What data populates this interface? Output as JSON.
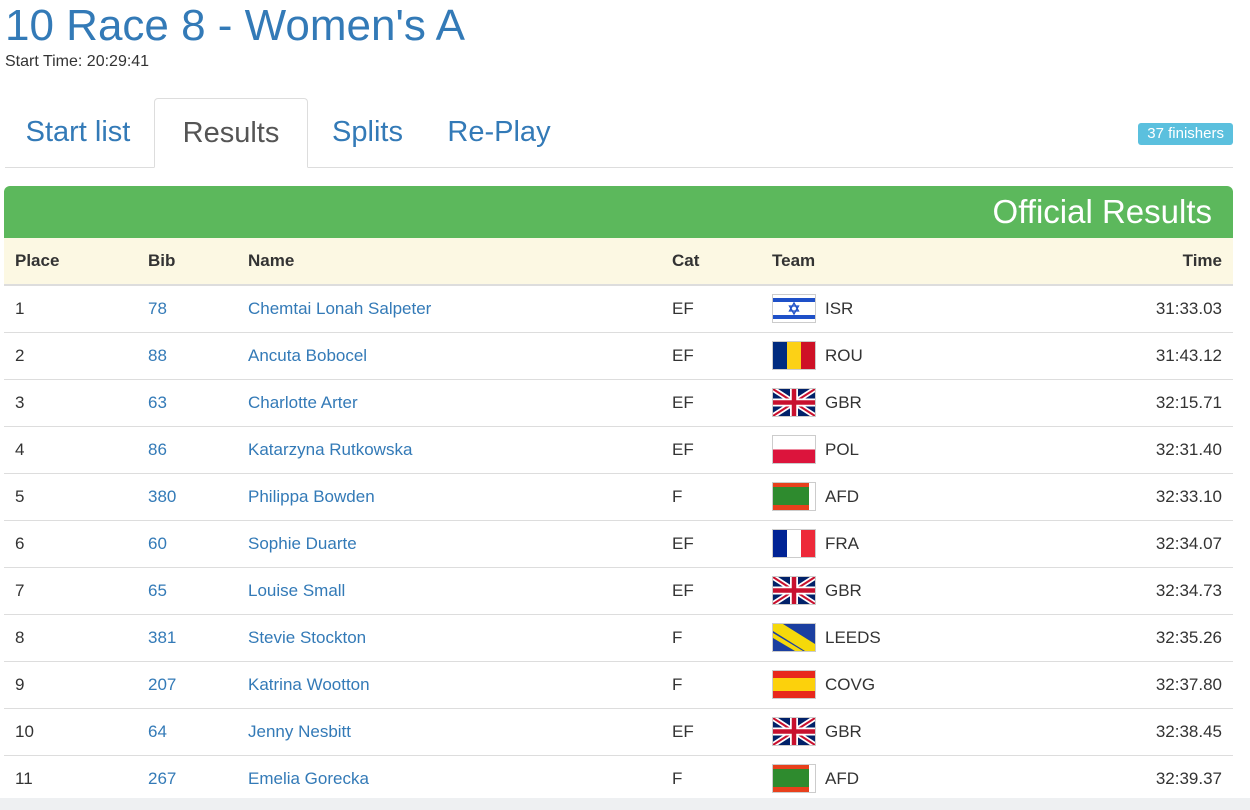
{
  "page": {
    "title": "10 Race 8 - Women's A",
    "start_time": "Start Time: 20:29:41"
  },
  "tabs": [
    {
      "label": "Start list",
      "active": false
    },
    {
      "label": "Results",
      "active": true
    },
    {
      "label": "Splits",
      "active": false
    },
    {
      "label": "Re-Play",
      "active": false
    }
  ],
  "finishers_badge": "37 finishers",
  "results": {
    "banner_title": "Official Results",
    "columns": [
      "Place",
      "Bib",
      "Name",
      "Cat",
      "Team",
      "Time"
    ],
    "rows": [
      {
        "place": "1",
        "bib": "78",
        "name": "Chemtai Lonah Salpeter",
        "cat": "EF",
        "team": "ISR",
        "flag": "israel-flag",
        "time": "31:33.03"
      },
      {
        "place": "2",
        "bib": "88",
        "name": "Ancuta Bobocel",
        "cat": "EF",
        "team": "ROU",
        "flag": "romania-flag",
        "time": "31:43.12"
      },
      {
        "place": "3",
        "bib": "63",
        "name": "Charlotte Arter",
        "cat": "EF",
        "team": "GBR",
        "flag": "uk-flag",
        "time": "32:15.71"
      },
      {
        "place": "4",
        "bib": "86",
        "name": "Katarzyna Rutkowska",
        "cat": "EF",
        "team": "POL",
        "flag": "poland-flag",
        "time": "32:31.40"
      },
      {
        "place": "5",
        "bib": "380",
        "name": "Philippa Bowden",
        "cat": "F",
        "team": "AFD",
        "flag": "afd-club-flag",
        "time": "32:33.10"
      },
      {
        "place": "6",
        "bib": "60",
        "name": "Sophie Duarte",
        "cat": "EF",
        "team": "FRA",
        "flag": "france-flag",
        "time": "32:34.07"
      },
      {
        "place": "7",
        "bib": "65",
        "name": "Louise Small",
        "cat": "EF",
        "team": "GBR",
        "flag": "uk-flag",
        "time": "32:34.73"
      },
      {
        "place": "8",
        "bib": "381",
        "name": "Stevie Stockton",
        "cat": "F",
        "team": "LEEDS",
        "flag": "leeds-club-flag",
        "time": "32:35.26"
      },
      {
        "place": "9",
        "bib": "207",
        "name": "Katrina Wootton",
        "cat": "F",
        "team": "COVG",
        "flag": "covg-club-flag",
        "time": "32:37.80"
      },
      {
        "place": "10",
        "bib": "64",
        "name": "Jenny Nesbitt",
        "cat": "EF",
        "team": "GBR",
        "flag": "uk-flag",
        "time": "32:38.45"
      },
      {
        "place": "11",
        "bib": "267",
        "name": "Emelia Gorecka",
        "cat": "F",
        "team": "AFD",
        "flag": "afd-club-flag",
        "time": "32:39.37"
      }
    ]
  },
  "colors": {
    "link": "#337ab7",
    "banner_green": "#5cb85c",
    "badge_blue": "#5bc0de",
    "header_bg": "#fcf8e3"
  }
}
